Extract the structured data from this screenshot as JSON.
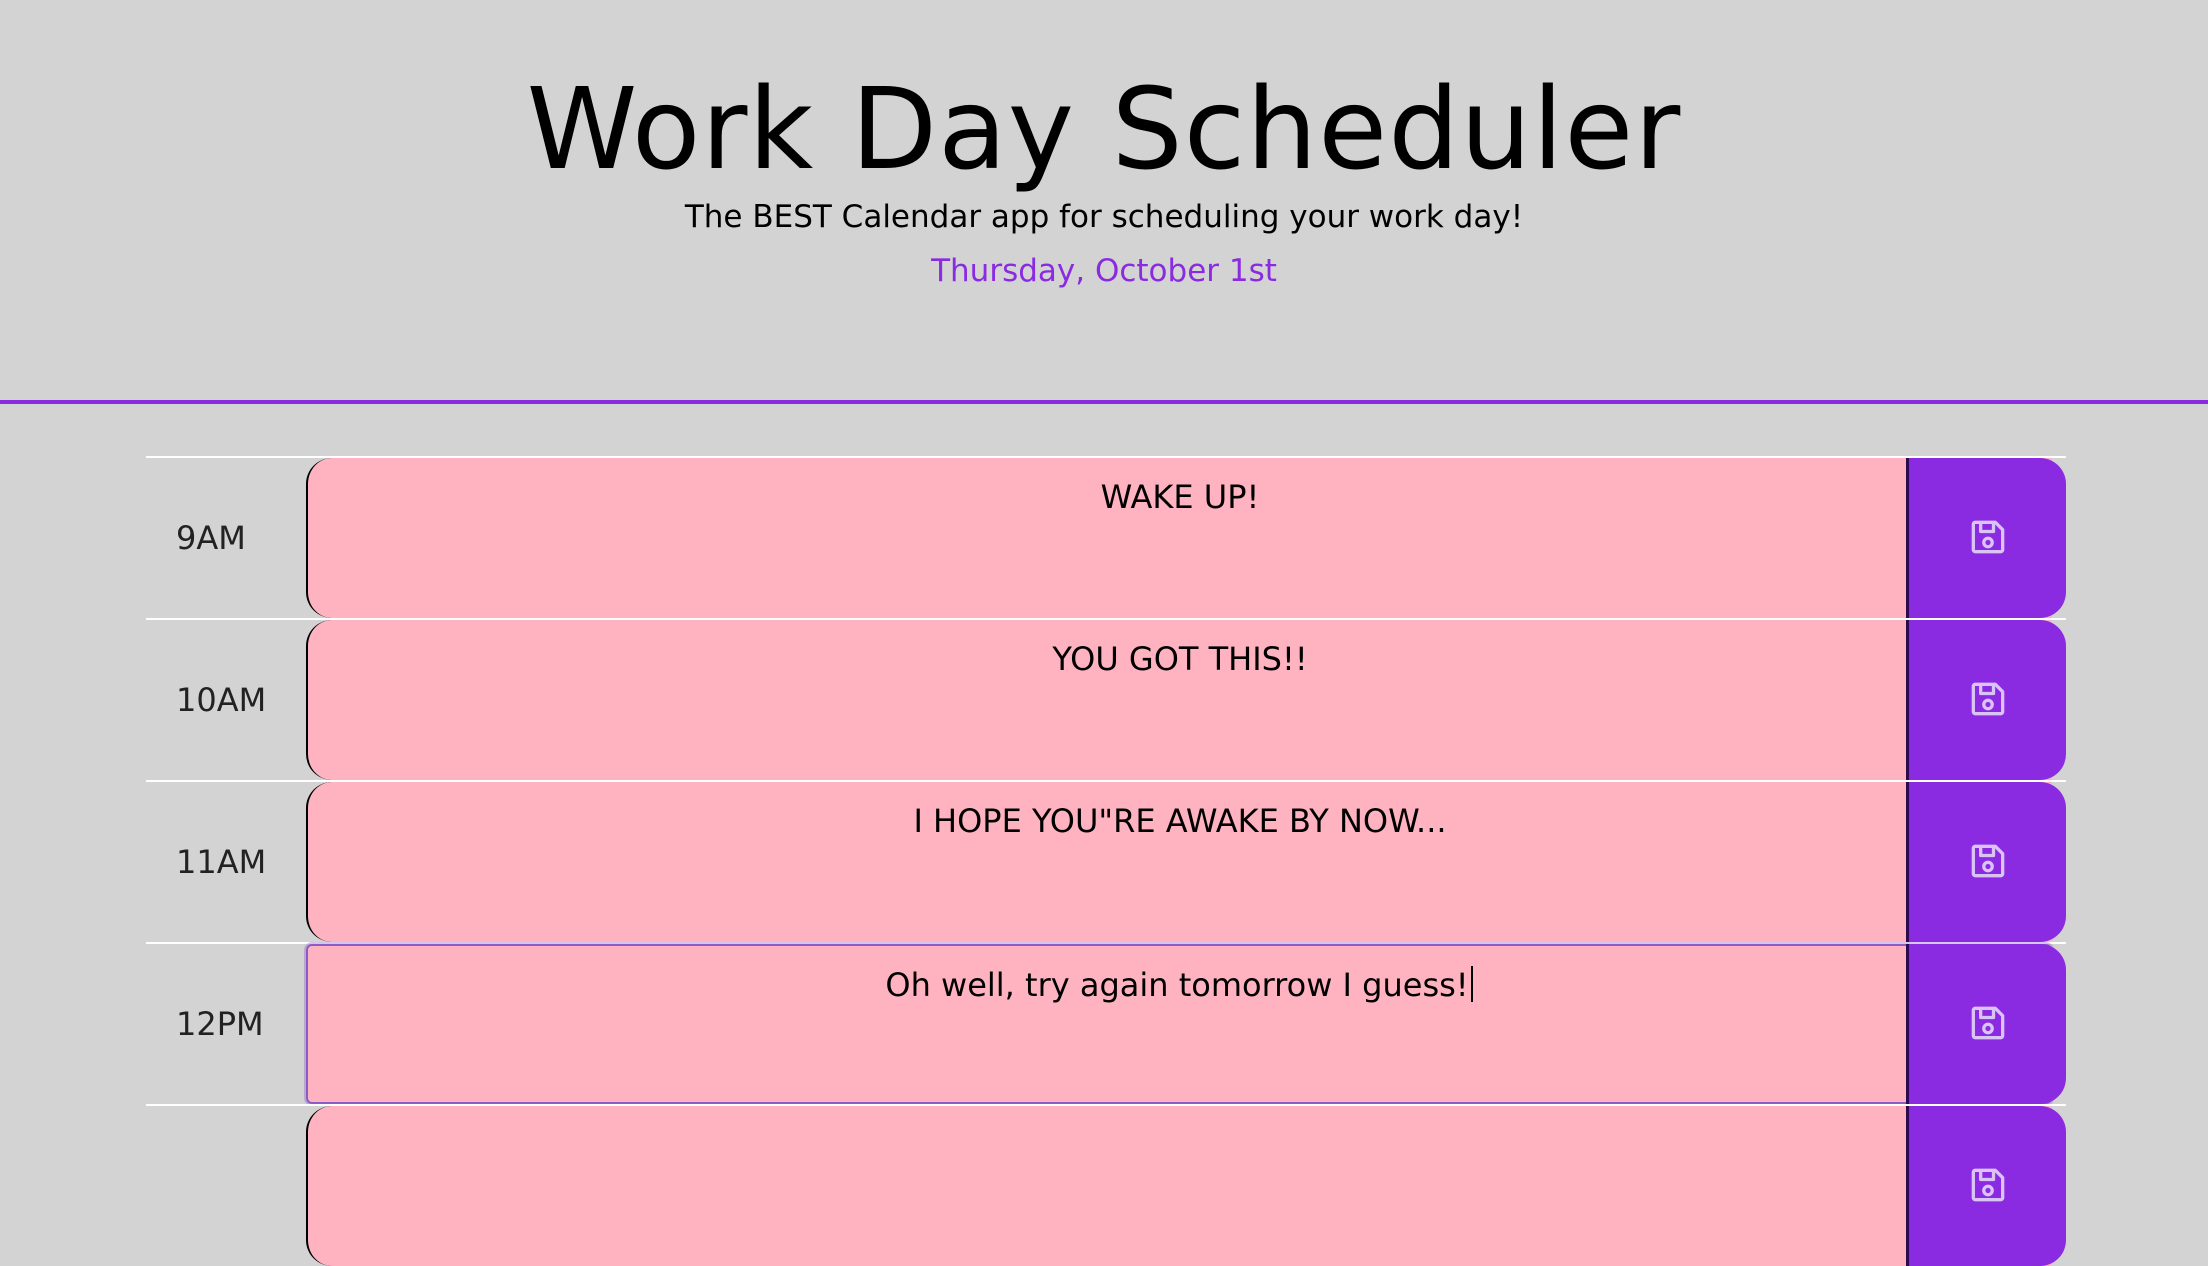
{
  "header": {
    "title": "Work Day Scheduler",
    "lead": "The BEST Calendar app for scheduling your work day!",
    "current_day": "Thursday, October 1st"
  },
  "colors": {
    "accent": "#8a2be2",
    "row_background": "#ffb3c0",
    "page_background": "#d3d3d3",
    "date_text": "#8a2be2"
  },
  "rows": [
    {
      "hour": "9AM",
      "text": "WAKE UP!",
      "save_icon": "save-icon"
    },
    {
      "hour": "10AM",
      "text": "YOU GOT THIS!!",
      "save_icon": "save-icon"
    },
    {
      "hour": "11AM",
      "text": "I HOPE YOU\"RE AWAKE BY NOW...",
      "save_icon": "save-icon"
    },
    {
      "hour": "12PM",
      "text": "Oh well, try again tomorrow I guess!",
      "save_icon": "save-icon"
    },
    {
      "hour": "",
      "text": "",
      "save_icon": "save-icon"
    }
  ]
}
